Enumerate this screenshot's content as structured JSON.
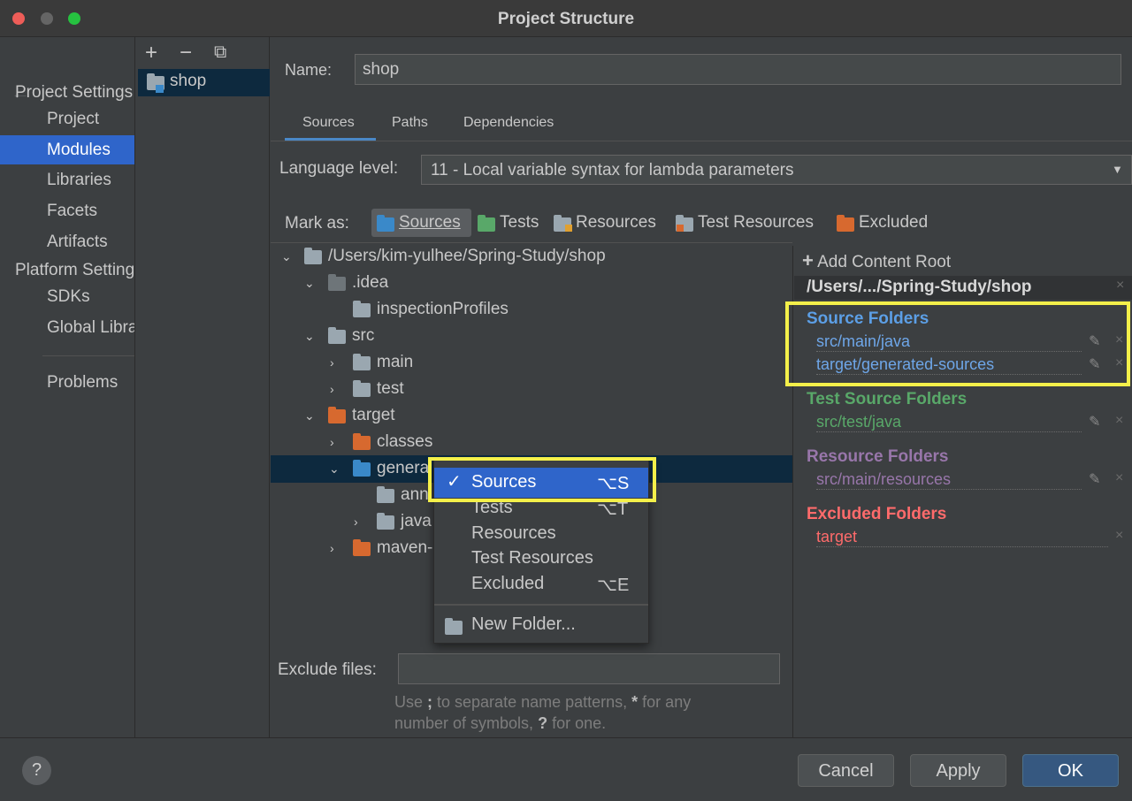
{
  "window": {
    "title": "Project Structure"
  },
  "nav": {
    "sections": [
      {
        "label": "Project Settings",
        "items": [
          "Project",
          "Modules",
          "Libraries",
          "Facets",
          "Artifacts"
        ]
      },
      {
        "label": "Platform Settings",
        "items": [
          "SDKs",
          "Global Libraries"
        ]
      }
    ],
    "problems": "Problems",
    "selected": "Modules",
    "back_glyph": "←",
    "forward_glyph": "→"
  },
  "modules": {
    "toolbar": {
      "add": "+",
      "remove": "−",
      "copy": "⧉"
    },
    "items": [
      "shop"
    ]
  },
  "name_field": {
    "label": "Name:",
    "value": "shop"
  },
  "tabs": [
    {
      "label": "Sources",
      "active": true
    },
    {
      "label": "Paths"
    },
    {
      "label": "Dependencies"
    }
  ],
  "language_level": {
    "label": "Language level:",
    "value": "11 - Local variable syntax for lambda parameters"
  },
  "mark_as": {
    "label": "Mark as:",
    "options": [
      {
        "label": "Sources",
        "color": "#3a89c9",
        "active": true
      },
      {
        "label": "Tests",
        "color": "#59a869"
      },
      {
        "label": "Resources",
        "color": "#9aa7b0"
      },
      {
        "label": "Test Resources",
        "color": "#9aa7b0"
      },
      {
        "label": "Excluded",
        "color": "#d7692f"
      }
    ]
  },
  "tree": [
    {
      "label": "/Users/kim-yulhee/Spring-Study/shop",
      "level": 0,
      "expanded": true,
      "color": "gray"
    },
    {
      "label": ".idea",
      "level": 1,
      "expanded": true,
      "color": "dark"
    },
    {
      "label": "inspectionProfiles",
      "level": 2,
      "leaf": true,
      "color": "gray"
    },
    {
      "label": "src",
      "level": 1,
      "expanded": true,
      "color": "gray"
    },
    {
      "label": "main",
      "level": 2,
      "expanded": false,
      "color": "gray"
    },
    {
      "label": "test",
      "level": 2,
      "expanded": false,
      "color": "gray"
    },
    {
      "label": "target",
      "level": 1,
      "expanded": true,
      "color": "orange"
    },
    {
      "label": "classes",
      "level": 2,
      "expanded": false,
      "color": "orange"
    },
    {
      "label": "generated-sources",
      "visible": "genera",
      "level": 2,
      "expanded": true,
      "color": "blue",
      "selected": true
    },
    {
      "label": "annotations",
      "visible": "ann",
      "level": 3,
      "leaf": true,
      "color": "gray"
    },
    {
      "label": "java",
      "visible": "java",
      "level": 3,
      "expanded": false,
      "color": "gray"
    },
    {
      "label": "maven-status",
      "visible": "maven-",
      "level": 2,
      "expanded": false,
      "color": "orange"
    }
  ],
  "context_menu": {
    "items": [
      {
        "label": "Sources",
        "shortcut": "⌥S",
        "checked": true,
        "check": "✓"
      },
      {
        "label": "Tests",
        "shortcut": "⌥T"
      },
      {
        "label": "Resources",
        "shortcut": ""
      },
      {
        "label": "Test Resources",
        "shortcut": ""
      },
      {
        "label": "Excluded",
        "shortcut": "⌥E"
      }
    ],
    "new_folder": "New Folder..."
  },
  "exclude_files": {
    "label": "Exclude files:",
    "value": "",
    "hint_line1_a": "Use ",
    "hint_line1_b": ";",
    "hint_line1_c": " to separate name patterns, ",
    "hint_line1_d": "*",
    "hint_line1_e": " for any",
    "hint_line2_a": "number of symbols, ",
    "hint_line2_b": "?",
    "hint_line2_c": " for one."
  },
  "content_root": {
    "add_label": "Add Content Root",
    "add_icon": "+",
    "path": "/Users/.../Spring-Study/shop",
    "groups": [
      {
        "title": "Source Folders",
        "color": "#5c9fe6",
        "path_color": "#6ea6e8",
        "paths": [
          "src/main/java",
          "target/generated-sources"
        ]
      },
      {
        "title": "Test Source Folders",
        "color": "#59a869",
        "path_color": "#59a869",
        "paths": [
          "src/test/java"
        ]
      },
      {
        "title": "Resource Folders",
        "color": "#9876aa",
        "path_color": "#9876aa",
        "paths": [
          "src/main/resources"
        ]
      },
      {
        "title": "Excluded Folders",
        "color": "#ff6b6b",
        "path_color": "#ff6b6b",
        "paths": [
          "target"
        ]
      }
    ],
    "edit_glyph": "✎",
    "remove_glyph": "×"
  },
  "buttons": {
    "help": "?",
    "cancel": "Cancel",
    "apply": "Apply",
    "ok": "OK"
  },
  "colors": {
    "selection": "#2f65ca",
    "highlight": "#f4f04a",
    "tree_selection": "#0d293e",
    "ok_button": "#365880"
  }
}
